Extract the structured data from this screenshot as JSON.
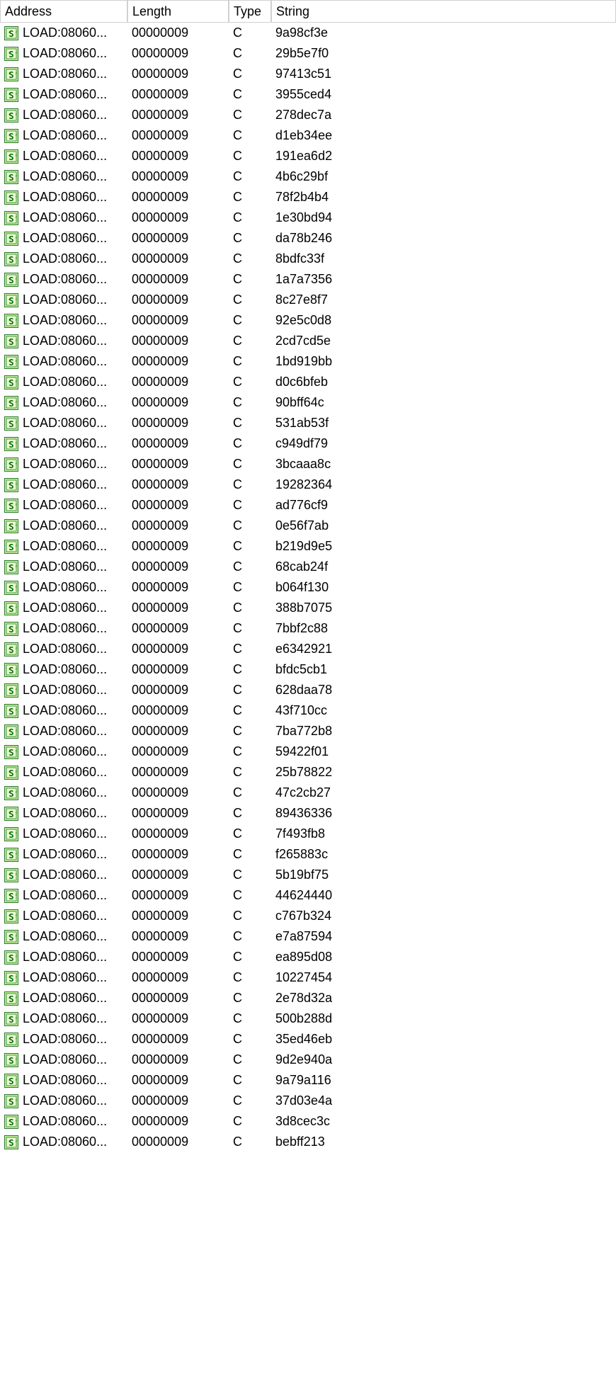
{
  "columns": {
    "address": "Address",
    "length": "Length",
    "type": "Type",
    "string": "String"
  },
  "address_display": "LOAD:08060...",
  "length_value": "00000009",
  "type_value": "C",
  "rows": [
    {
      "string": "9a98cf3e"
    },
    {
      "string": "29b5e7f0"
    },
    {
      "string": "97413c51"
    },
    {
      "string": "3955ced4"
    },
    {
      "string": "278dec7a"
    },
    {
      "string": "d1eb34ee"
    },
    {
      "string": "191ea6d2"
    },
    {
      "string": "4b6c29bf"
    },
    {
      "string": "78f2b4b4"
    },
    {
      "string": "1e30bd94"
    },
    {
      "string": "da78b246"
    },
    {
      "string": "8bdfc33f"
    },
    {
      "string": "1a7a7356"
    },
    {
      "string": "8c27e8f7"
    },
    {
      "string": "92e5c0d8"
    },
    {
      "string": "2cd7cd5e"
    },
    {
      "string": "1bd919bb"
    },
    {
      "string": "d0c6bfeb"
    },
    {
      "string": "90bff64c"
    },
    {
      "string": "531ab53f"
    },
    {
      "string": "c949df79"
    },
    {
      "string": "3bcaaa8c"
    },
    {
      "string": "19282364"
    },
    {
      "string": "ad776cf9"
    },
    {
      "string": "0e56f7ab"
    },
    {
      "string": "b219d9e5"
    },
    {
      "string": "68cab24f"
    },
    {
      "string": "b064f130"
    },
    {
      "string": "388b7075"
    },
    {
      "string": "7bbf2c88"
    },
    {
      "string": "e6342921"
    },
    {
      "string": "bfdc5cb1"
    },
    {
      "string": "628daa78"
    },
    {
      "string": "43f710cc"
    },
    {
      "string": "7ba772b8"
    },
    {
      "string": "59422f01"
    },
    {
      "string": "25b78822"
    },
    {
      "string": "47c2cb27"
    },
    {
      "string": "89436336"
    },
    {
      "string": "7f493fb8"
    },
    {
      "string": "f265883c"
    },
    {
      "string": "5b19bf75"
    },
    {
      "string": "44624440"
    },
    {
      "string": "c767b324"
    },
    {
      "string": "e7a87594"
    },
    {
      "string": "ea895d08"
    },
    {
      "string": "10227454"
    },
    {
      "string": "2e78d32a"
    },
    {
      "string": "500b288d"
    },
    {
      "string": "35ed46eb"
    },
    {
      "string": "9d2e940a"
    },
    {
      "string": "9a79a116"
    },
    {
      "string": "37d03e4a"
    },
    {
      "string": "3d8cec3c"
    },
    {
      "string": "bebff213"
    }
  ]
}
